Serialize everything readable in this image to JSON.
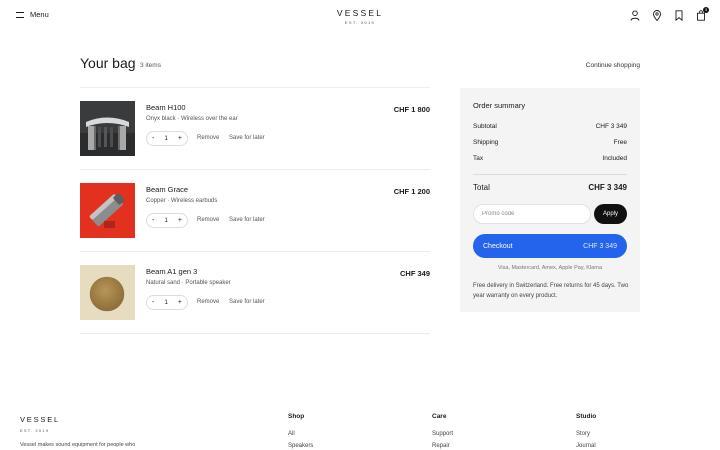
{
  "header": {
    "menu_label": "Menu",
    "brand_name": "VESSEL",
    "brand_tagline": "EST. 2019",
    "cart_count": "3",
    "icons": [
      "user-icon",
      "location-pin-icon",
      "bookmark-icon",
      "shopping-bag-icon"
    ]
  },
  "bag": {
    "title": "Your bag",
    "count_label": "3 items",
    "continue_label": "Continue shopping"
  },
  "items": [
    {
      "name": "Beam H100",
      "variant": "Onyx black · Wireless over the ear",
      "price": "CHF 1 800",
      "qty": "1",
      "remove_label": "Remove",
      "save_label": "Save for later",
      "thumb_bg": "#3a3b3d"
    },
    {
      "name": "Beam Grace",
      "variant": "Copper · Wireless earbuds",
      "price": "CHF 1 200",
      "qty": "1",
      "remove_label": "Remove",
      "save_label": "Save for later",
      "thumb_bg": "#e2321f"
    },
    {
      "name": "Beam A1 gen 3",
      "variant": "Natural sand · Portable speaker",
      "price": "CHF 349",
      "qty": "1",
      "remove_label": "Remove",
      "save_label": "Save for later",
      "thumb_bg": "#e8dcc0"
    }
  ],
  "qty_controls": {
    "minus": "-",
    "plus": "+"
  },
  "summary": {
    "title": "Order summary",
    "subtotal_label": "Subtotal",
    "subtotal_value": "CHF 3 349",
    "shipping_label": "Shipping",
    "shipping_value": "Free",
    "tax_label": "Tax",
    "tax_value": "Included",
    "total_label": "Total",
    "total_value": "CHF 3 349",
    "promo_placeholder": "Promo code",
    "apply_label": "Apply",
    "checkout_label": "Checkout",
    "checkout_amount": "CHF 3 349",
    "payment_methods": "Visa, Mastercard, Amex, Apple Pay, Klarna",
    "delivery_note": "Free delivery in Switzerland. Free returns for 45 days. Two year warranty on every product."
  },
  "footer": {
    "brand_name": "VESSEL",
    "brand_tagline": "EST. 2019",
    "description": "Vessel makes sound equipment for people who",
    "columns": [
      {
        "title": "Shop",
        "links": [
          "All",
          "Speakers"
        ]
      },
      {
        "title": "Care",
        "links": [
          "Support",
          "Repair"
        ]
      },
      {
        "title": "Studio",
        "links": [
          "Story",
          "Journal"
        ]
      }
    ]
  },
  "colors": {
    "accent": "#2463eb",
    "summary_bg": "#f4f4f4",
    "dark": "#111111"
  }
}
